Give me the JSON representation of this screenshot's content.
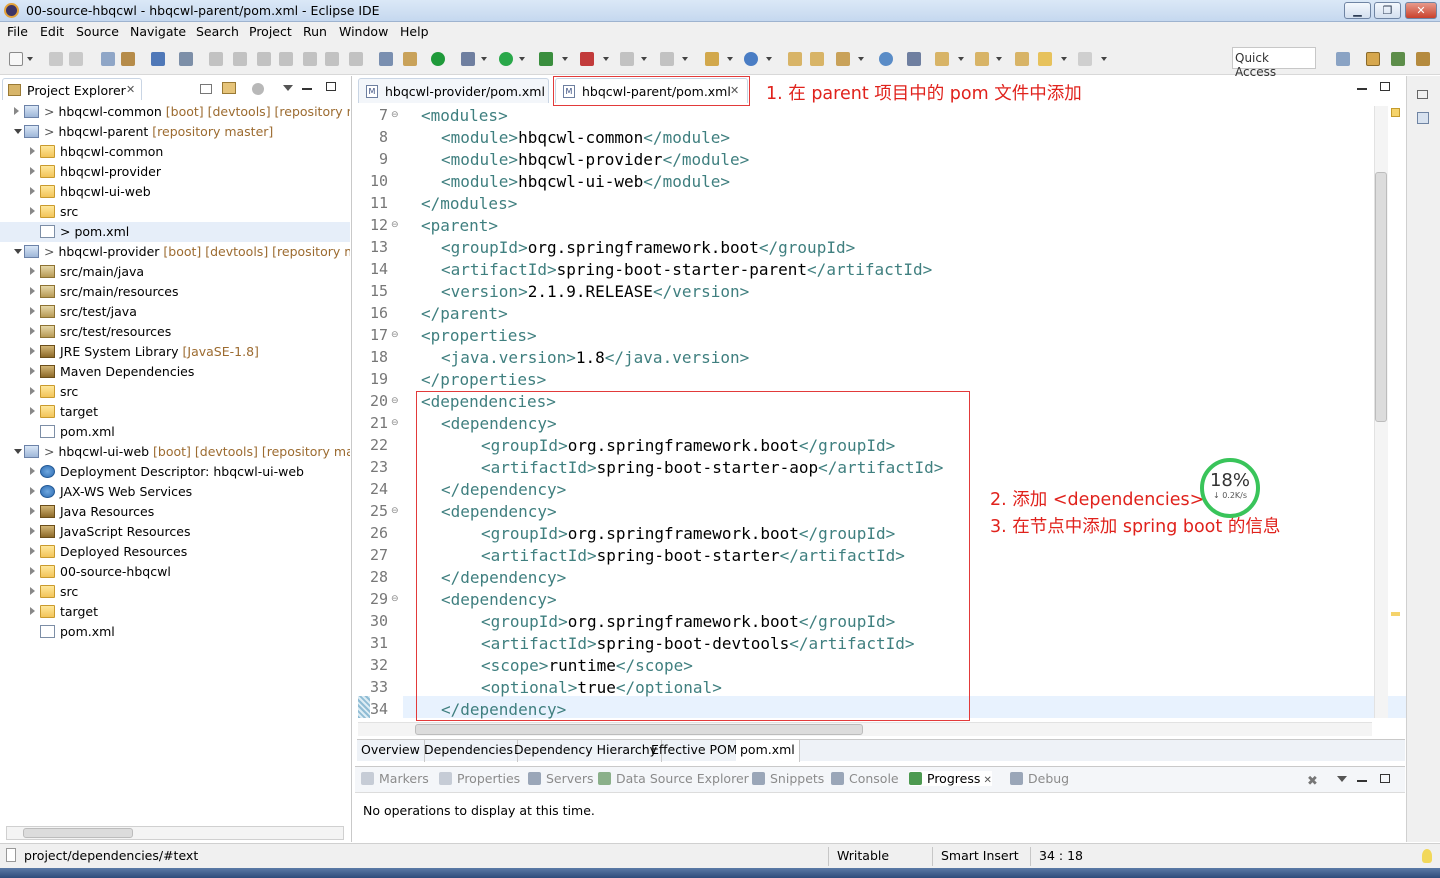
{
  "window": {
    "title": "00-source-hbqcwl - hbqcwl-parent/pom.xml - Eclipse IDE",
    "minimize": "▁",
    "restore": "❐",
    "close": "✕"
  },
  "menu": [
    "File",
    "Edit",
    "Source",
    "Navigate",
    "Search",
    "Project",
    "Run",
    "Window",
    "Help"
  ],
  "toolbar": {
    "quick_access_placeholder": "Quick Access"
  },
  "explorer": {
    "title": "Project Explorer",
    "close_glyph": "✕",
    "rows": [
      {
        "name": "hbqcwl-common",
        "decor": "[boot] [devtools] [repository mas"
      },
      {
        "name": "hbqcwl-parent",
        "decor": "[repository master]"
      },
      {
        "name": "hbqcwl-common",
        "decor": ""
      },
      {
        "name": "hbqcwl-provider",
        "decor": ""
      },
      {
        "name": "hbqcwl-ui-web",
        "decor": ""
      },
      {
        "name": "src",
        "decor": ""
      },
      {
        "name": "> pom.xml",
        "decor": ""
      },
      {
        "name": "hbqcwl-provider",
        "decor": "[boot] [devtools] [repository mas"
      },
      {
        "name": "src/main/java",
        "decor": ""
      },
      {
        "name": "src/main/resources",
        "decor": ""
      },
      {
        "name": "src/test/java",
        "decor": ""
      },
      {
        "name": "src/test/resources",
        "decor": ""
      },
      {
        "name": "JRE System Library",
        "decor": "[JavaSE-1.8]"
      },
      {
        "name": "Maven Dependencies",
        "decor": ""
      },
      {
        "name": "src",
        "decor": ""
      },
      {
        "name": "target",
        "decor": ""
      },
      {
        "name": "pom.xml",
        "decor": ""
      },
      {
        "name": "hbqcwl-ui-web",
        "decor": "[boot] [devtools] [repository maste"
      },
      {
        "name": "Deployment Descriptor: hbqcwl-ui-web",
        "decor": ""
      },
      {
        "name": "JAX-WS Web Services",
        "decor": ""
      },
      {
        "name": "Java Resources",
        "decor": ""
      },
      {
        "name": "JavaScript Resources",
        "decor": ""
      },
      {
        "name": "Deployed Resources",
        "decor": ""
      },
      {
        "name": "00-source-hbqcwl",
        "decor": ""
      },
      {
        "name": "src",
        "decor": ""
      },
      {
        "name": "target",
        "decor": ""
      },
      {
        "name": "pom.xml",
        "decor": ""
      }
    ]
  },
  "editor": {
    "tabs": [
      {
        "label": "hbqcwl-provider/pom.xml"
      },
      {
        "label": "hbqcwl-parent/pom.xml",
        "close": "✕"
      }
    ],
    "lines": [
      {
        "n": "7",
        "t": "<modules>",
        "i": 0
      },
      {
        "n": "8",
        "t": "<module>",
        "v": "hbqcwl-common",
        "c": "</module>",
        "i": 1
      },
      {
        "n": "9",
        "t": "<module>",
        "v": "hbqcwl-provider",
        "c": "</module>",
        "i": 1
      },
      {
        "n": "10",
        "t": "<module>",
        "v": "hbqcwl-ui-web",
        "c": "</module>",
        "i": 1
      },
      {
        "n": "11",
        "t": "</modules>",
        "i": 0
      },
      {
        "n": "12",
        "t": "<parent>",
        "i": 0
      },
      {
        "n": "13",
        "t": "<groupId>",
        "v": "org.springframework.boot",
        "c": "</groupId>",
        "i": 1
      },
      {
        "n": "14",
        "t": "<artifactId>",
        "v": "spring-boot-starter-parent",
        "c": "</artifactId>",
        "i": 1
      },
      {
        "n": "15",
        "t": "<version>",
        "v": "2.1.9.RELEASE",
        "c": "</version>",
        "i": 1
      },
      {
        "n": "16",
        "t": "</parent>",
        "i": 0
      },
      {
        "n": "17",
        "t": "<properties>",
        "i": 0
      },
      {
        "n": "18",
        "t": "<java.version>",
        "v": "1.8",
        "c": "</java.version>",
        "i": 1
      },
      {
        "n": "19",
        "t": "</properties>",
        "i": 0
      },
      {
        "n": "20",
        "t": "<dependencies>",
        "i": 0
      },
      {
        "n": "21",
        "t": "<dependency>",
        "i": 1
      },
      {
        "n": "22",
        "t": "<groupId>",
        "v": "org.springframework.boot",
        "c": "</groupId>",
        "i": 3
      },
      {
        "n": "23",
        "t": "<artifactId>",
        "v": "spring-boot-starter-aop",
        "c": "</artifactId>",
        "i": 3
      },
      {
        "n": "24",
        "t": "</dependency>",
        "i": 1
      },
      {
        "n": "25",
        "t": "<dependency>",
        "i": 1
      },
      {
        "n": "26",
        "t": "<groupId>",
        "v": "org.springframework.boot",
        "c": "</groupId>",
        "i": 3
      },
      {
        "n": "27",
        "t": "<artifactId>",
        "v": "spring-boot-starter",
        "c": "</artifactId>",
        "i": 3
      },
      {
        "n": "28",
        "t": "</dependency>",
        "i": 1
      },
      {
        "n": "29",
        "t": "<dependency>",
        "i": 1
      },
      {
        "n": "30",
        "t": "<groupId>",
        "v": "org.springframework.boot",
        "c": "</groupId>",
        "i": 3
      },
      {
        "n": "31",
        "t": "<artifactId>",
        "v": "spring-boot-devtools",
        "c": "</artifactId>",
        "i": 3
      },
      {
        "n": "32",
        "t": "<scope>",
        "v": "runtime",
        "c": "</scope>",
        "i": 3
      },
      {
        "n": "33",
        "t": "<optional>",
        "v": "true",
        "c": "</optional>",
        "i": 3
      },
      {
        "n": "34",
        "t": "</dependency>",
        "i": 1
      }
    ],
    "fold_marker": "⊖",
    "pom_tabs": [
      "Overview",
      "Dependencies",
      "Dependency Hierarchy",
      "Effective POM",
      "pom.xml"
    ]
  },
  "annotations": {
    "note1": "1. 在 parent 项目中的 pom 文件中添加",
    "note2": "2. 添加 <dependencies> 节点",
    "note3": "3. 在节点中添加 spring boot 的信息"
  },
  "gadget": {
    "percent": "18%",
    "speed": "↓ 0.2K/s"
  },
  "bottom": {
    "tabs": [
      "Markers",
      "Properties",
      "Servers",
      "Data Source Explorer",
      "Snippets",
      "Console",
      "Progress",
      "Debug"
    ],
    "active_tab": "Progress",
    "message": "No operations to display at this time."
  },
  "status": {
    "path": "project/dependencies/#text",
    "mode": "Writable",
    "insert": "Smart Insert",
    "position": "34 : 18"
  },
  "colors": {
    "tag": "#3f7f7f",
    "annotation": "#e0221c",
    "current_line": "#e8f2fe"
  }
}
